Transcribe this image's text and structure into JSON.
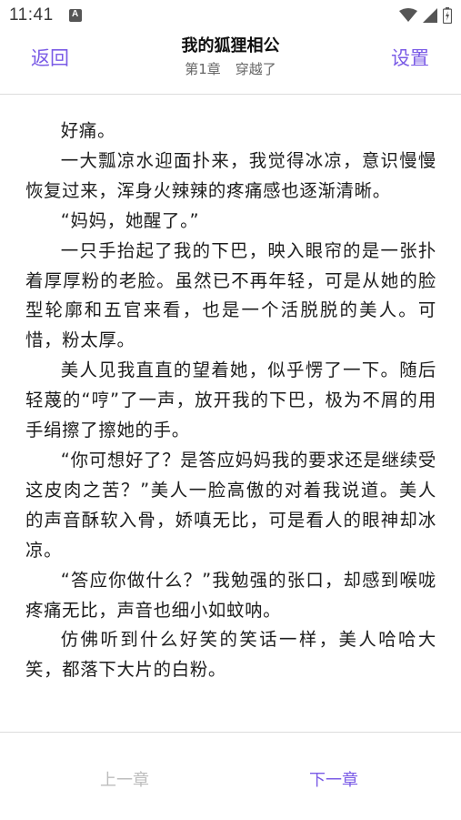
{
  "status_bar": {
    "time": "11:41"
  },
  "header": {
    "back_label": "返回",
    "title": "我的狐狸相公",
    "chapter_number": "第1章",
    "chapter_title": "穿越了",
    "settings_label": "设置"
  },
  "content": {
    "paragraphs": [
      "好痛。",
      "一大瓢凉水迎面扑来，我觉得冰凉，意识慢慢恢复过来，浑身火辣辣的疼痛感也逐渐清晰。",
      "“妈妈，她醒了。”",
      "一只手抬起了我的下巴，映入眼帘的是一张扑着厚厚粉的老脸。虽然已不再年轻，可是从她的脸型轮廓和五官来看，也是一个活脱脱的美人。可惜，粉太厚。",
      "美人见我直直的望着她，似乎愣了一下。随后轻蔑的“哼”了一声，放开我的下巴，极为不屑的用手绢擦了擦她的手。",
      "“你可想好了？是答应妈妈我的要求还是继续受这皮肉之苦？”美人一脸高傲的对着我说道。美人的声音酥软入骨，娇嗔无比，可是看人的眼神却冰凉。",
      "“答应你做什么？”我勉强的张口，却感到喉咙疼痛无比，声音也细小如蚊呐。",
      "仿佛听到什么好笑的笑话一样，美人哈哈大笑，都落下大片的白粉。"
    ]
  },
  "bottom_nav": {
    "prev_label": "上一章",
    "next_label": "下一章"
  },
  "colors": {
    "accent": "#7b5ce6",
    "disabled": "#bdbdbd"
  }
}
